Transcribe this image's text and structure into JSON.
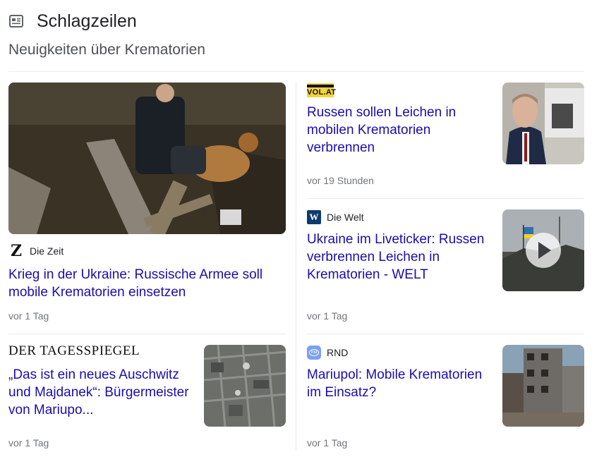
{
  "header": {
    "title": "Schlagzeilen",
    "subtitle": "Neuigkeiten über Krematorien"
  },
  "articles": [
    {
      "source": "Die Zeit",
      "source_logo_icon": "zeit-logo-icon",
      "headline": "Krieg in der Ukraine: Russische Armee soll mobile Krematorien einsetzen",
      "time": "vor 1 Tag"
    },
    {
      "source": "DER TAGESSPIEGEL",
      "source_logo_icon": "tagesspiegel-logo-icon",
      "headline": "„Das ist ein neues Auschwitz und Majdanek“: Bürgermeister von Mariupo...",
      "time": "vor 1 Tag"
    },
    {
      "source": "VOL.AT",
      "source_logo_icon": "vol-at-logo-icon",
      "headline": "Russen sollen Leichen in mobilen Krematorien verbrennen",
      "time": "vor 19 Stunden"
    },
    {
      "source": "Die Welt",
      "source_logo_icon": "welt-logo-icon",
      "headline": "Ukraine im Liveticker: Russen verbrennen Leichen in Krematorien - WELT",
      "time": "vor 1 Tag",
      "has_video": true
    },
    {
      "source": "RND",
      "source_logo_icon": "rnd-logo-icon",
      "headline": "Mariupol: Mobile Krematorien im Einsatz?",
      "time": "vor 1 Tag"
    }
  ],
  "colors": {
    "link": "#1a0dab",
    "meta": "#70757a",
    "divider": "#ebebeb"
  }
}
